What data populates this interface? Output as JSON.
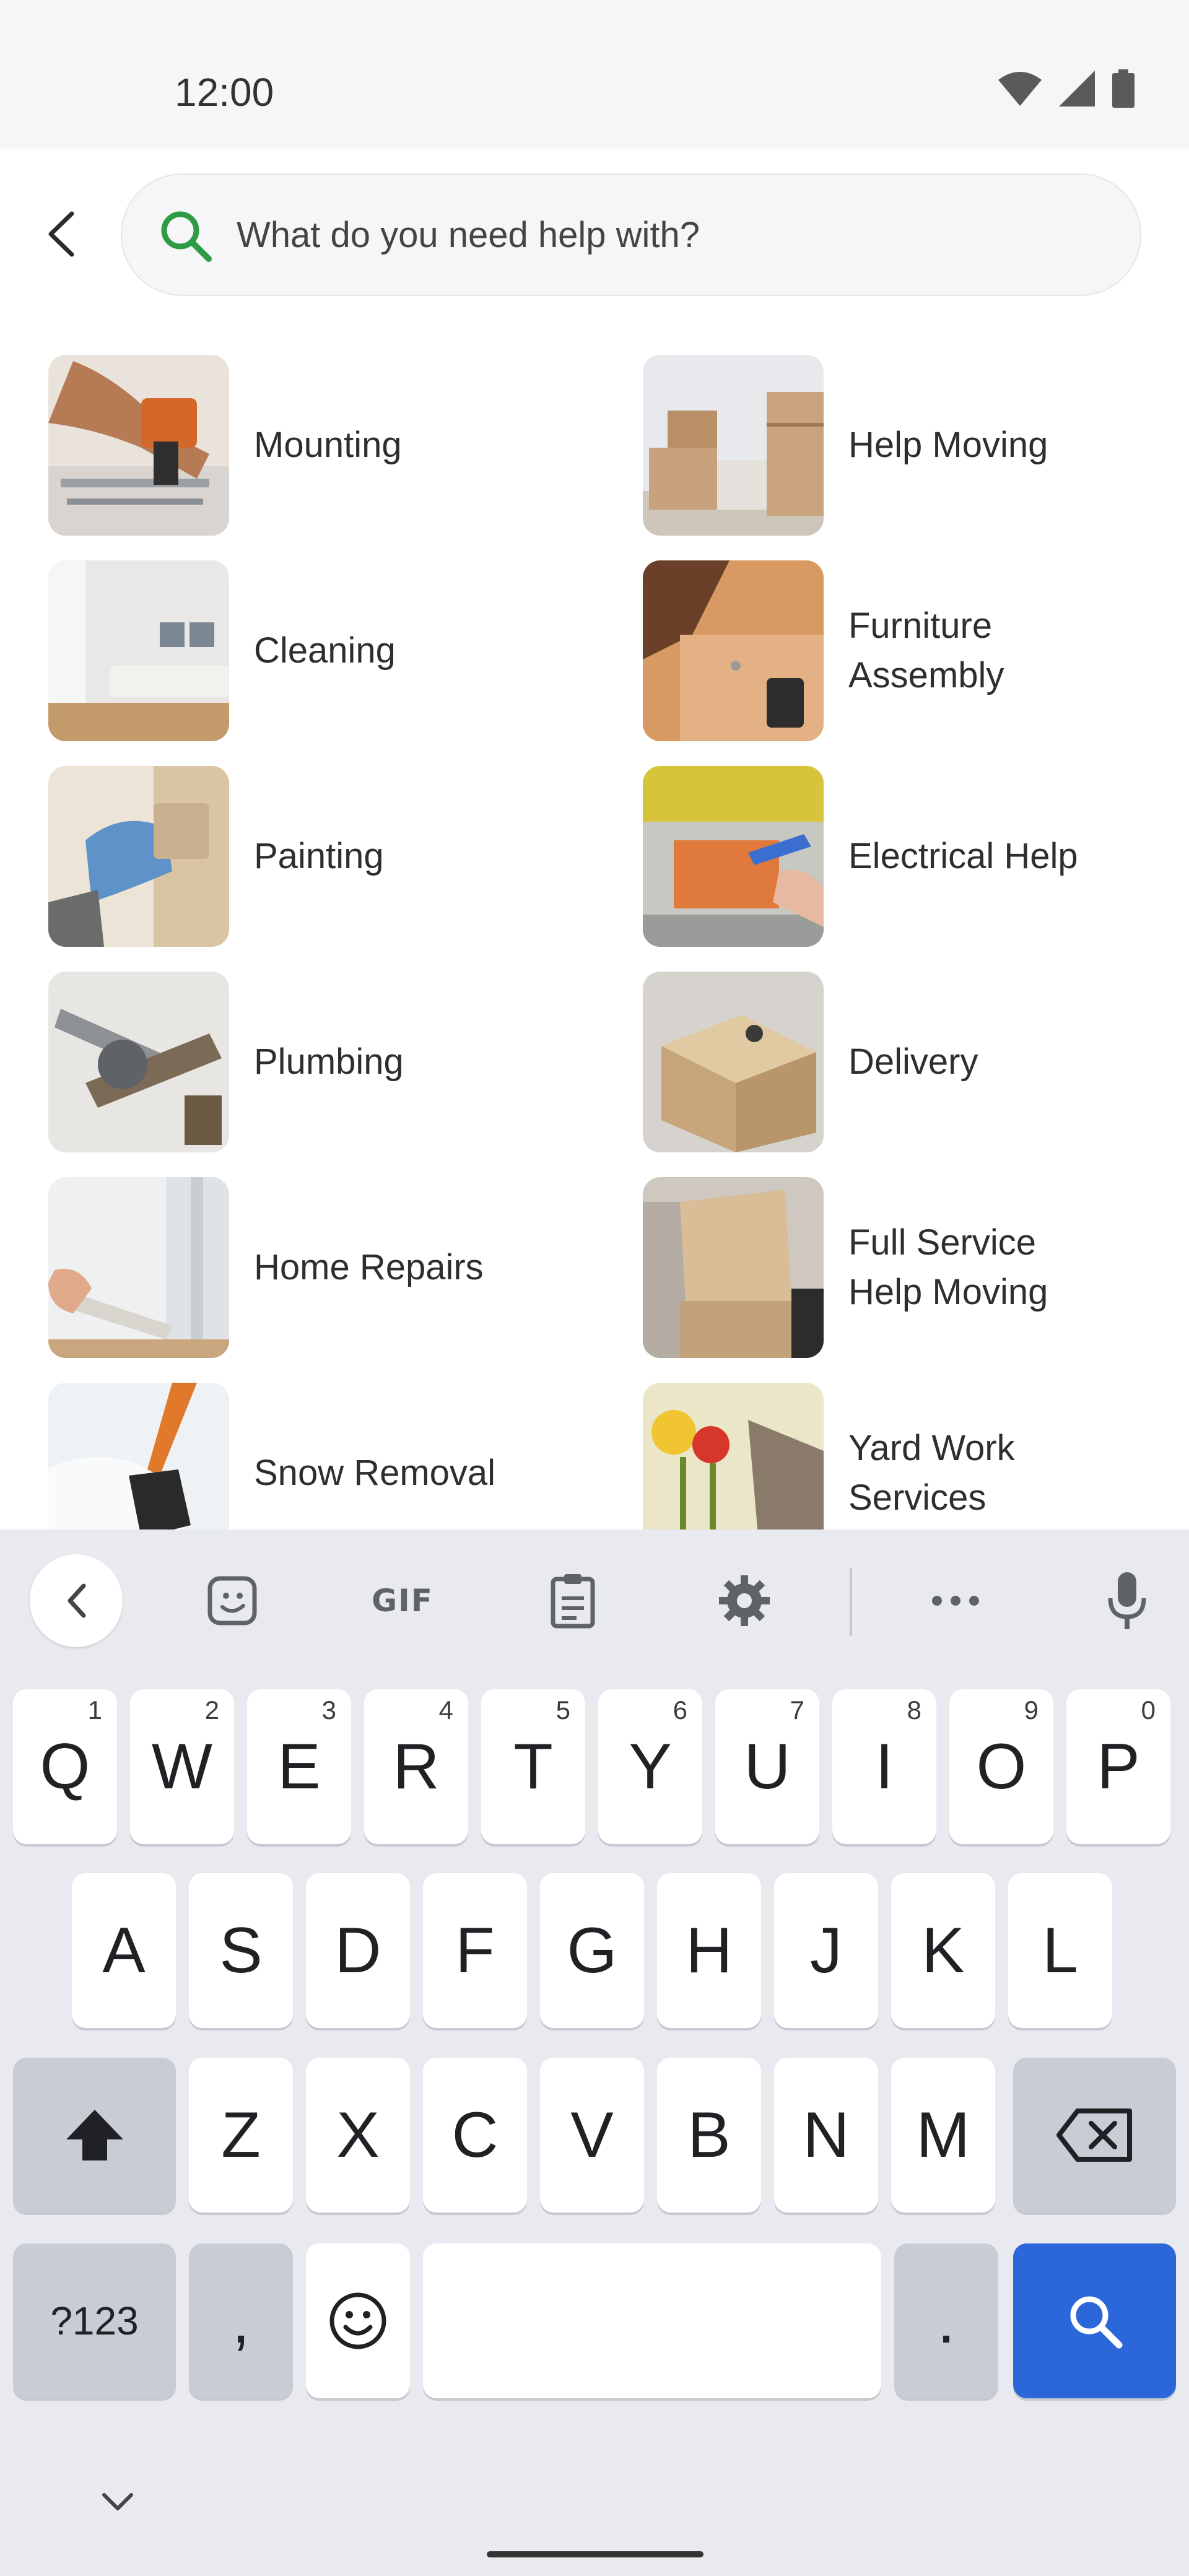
{
  "status_bar": {
    "time": "12:00"
  },
  "search": {
    "placeholder": "What do you need help with?"
  },
  "categories": [
    {
      "label": "Mounting",
      "icon": "mounting-photo"
    },
    {
      "label": "Help Moving",
      "icon": "moving-boxes-photo"
    },
    {
      "label": "Cleaning",
      "icon": "clean-room-photo"
    },
    {
      "label": "Furniture\nAssembly",
      "icon": "furniture-assembly-photo"
    },
    {
      "label": "Painting",
      "icon": "painting-photo"
    },
    {
      "label": "Electrical Help",
      "icon": "electrical-photo"
    },
    {
      "label": "Plumbing",
      "icon": "plumbing-tools-photo"
    },
    {
      "label": "Delivery",
      "icon": "delivery-box-photo"
    },
    {
      "label": "Home Repairs",
      "icon": "home-repairs-photo"
    },
    {
      "label": "Full Service\nHelp Moving",
      "icon": "full-service-moving-photo"
    },
    {
      "label": "Snow Removal",
      "icon": "snow-shovel-photo"
    },
    {
      "label": "Yard Work\nServices",
      "icon": "yard-work-photo"
    }
  ],
  "keyboard": {
    "toolbar": {
      "gif_label": "GIF"
    },
    "row1": [
      {
        "key": "Q",
        "hint": "1"
      },
      {
        "key": "W",
        "hint": "2"
      },
      {
        "key": "E",
        "hint": "3"
      },
      {
        "key": "R",
        "hint": "4"
      },
      {
        "key": "T",
        "hint": "5"
      },
      {
        "key": "Y",
        "hint": "6"
      },
      {
        "key": "U",
        "hint": "7"
      },
      {
        "key": "I",
        "hint": "8"
      },
      {
        "key": "O",
        "hint": "9"
      },
      {
        "key": "P",
        "hint": "0"
      }
    ],
    "row2": [
      "A",
      "S",
      "D",
      "F",
      "G",
      "H",
      "J",
      "K",
      "L"
    ],
    "row3": [
      "Z",
      "X",
      "C",
      "V",
      "B",
      "N",
      "M"
    ],
    "symbols_label": "?123",
    "comma": ",",
    "period": ".",
    "accent_color": "#2b67d8"
  }
}
